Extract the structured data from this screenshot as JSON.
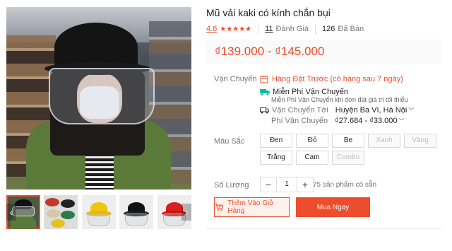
{
  "product": {
    "title": "Mũ vải kaki có kính chắn bụi",
    "rating": "4.6",
    "stars": "★★★★★",
    "reviews_count": "11",
    "reviews_label": "Đánh Giá",
    "sold_count": "126",
    "sold_label": "Đã Bán",
    "price_range": "₫139.000 - ₫145.000"
  },
  "shipping": {
    "label": "Vận Chuyển",
    "preorder": "Hàng Đặt Trước (có hàng sau 7 ngày)",
    "free_title": "Miễn Phí Vận Chuyển",
    "free_desc": "Miễn Phí Vận Chuyển khi đơn đạt giá trị tối thiểu",
    "to_label": "Vận Chuyển Tới",
    "to_value": "Huyện Ba Vì, Hà Nội",
    "fee_label": "Phí Vận Chuyển",
    "fee_value": "₫27.684 - ₫33.000"
  },
  "colors": {
    "label": "Màu Sắc",
    "options": [
      "Đen",
      "Đỏ",
      "Be",
      "Xanh",
      "Vàng",
      "Trắng",
      "Cam",
      "Combo"
    ],
    "disabled": [
      "Xanh",
      "Vàng",
      "Combo"
    ]
  },
  "quantity": {
    "label": "Số Lượng",
    "minus": "−",
    "value": "1",
    "plus": "+",
    "available": "75 sản phẩm có sẵn"
  },
  "actions": {
    "add_to_cart": "Thêm Vào Giỏ Hàng",
    "buy_now": "Mua Ngay"
  },
  "gallery": {
    "prev": "‹",
    "next": "›"
  },
  "theme": {
    "accent": "#ee4d2d",
    "free_ship": "#00bfa5"
  }
}
